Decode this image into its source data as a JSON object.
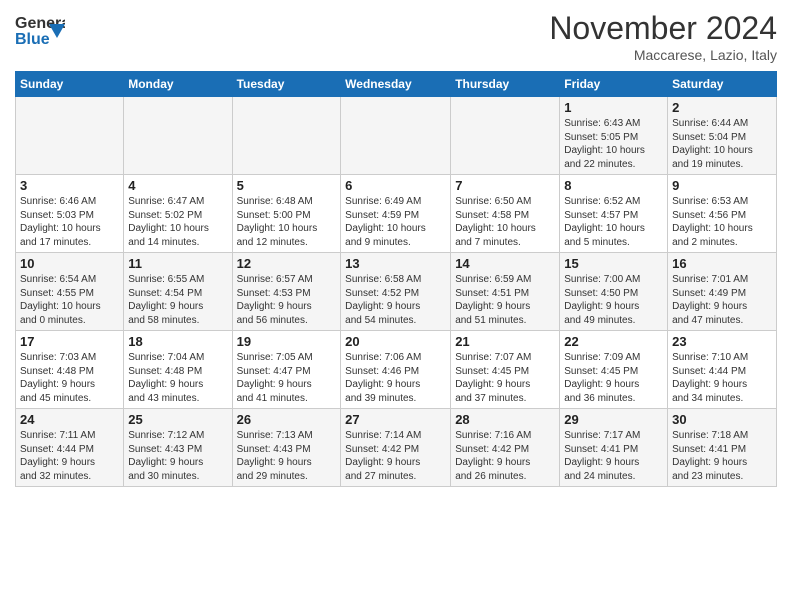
{
  "header": {
    "logo_line1": "General",
    "logo_line2": "Blue",
    "month": "November 2024",
    "location": "Maccarese, Lazio, Italy"
  },
  "weekdays": [
    "Sunday",
    "Monday",
    "Tuesday",
    "Wednesday",
    "Thursday",
    "Friday",
    "Saturday"
  ],
  "weeks": [
    [
      {
        "day": "",
        "info": ""
      },
      {
        "day": "",
        "info": ""
      },
      {
        "day": "",
        "info": ""
      },
      {
        "day": "",
        "info": ""
      },
      {
        "day": "",
        "info": ""
      },
      {
        "day": "1",
        "info": "Sunrise: 6:43 AM\nSunset: 5:05 PM\nDaylight: 10 hours\nand 22 minutes."
      },
      {
        "day": "2",
        "info": "Sunrise: 6:44 AM\nSunset: 5:04 PM\nDaylight: 10 hours\nand 19 minutes."
      }
    ],
    [
      {
        "day": "3",
        "info": "Sunrise: 6:46 AM\nSunset: 5:03 PM\nDaylight: 10 hours\nand 17 minutes."
      },
      {
        "day": "4",
        "info": "Sunrise: 6:47 AM\nSunset: 5:02 PM\nDaylight: 10 hours\nand 14 minutes."
      },
      {
        "day": "5",
        "info": "Sunrise: 6:48 AM\nSunset: 5:00 PM\nDaylight: 10 hours\nand 12 minutes."
      },
      {
        "day": "6",
        "info": "Sunrise: 6:49 AM\nSunset: 4:59 PM\nDaylight: 10 hours\nand 9 minutes."
      },
      {
        "day": "7",
        "info": "Sunrise: 6:50 AM\nSunset: 4:58 PM\nDaylight: 10 hours\nand 7 minutes."
      },
      {
        "day": "8",
        "info": "Sunrise: 6:52 AM\nSunset: 4:57 PM\nDaylight: 10 hours\nand 5 minutes."
      },
      {
        "day": "9",
        "info": "Sunrise: 6:53 AM\nSunset: 4:56 PM\nDaylight: 10 hours\nand 2 minutes."
      }
    ],
    [
      {
        "day": "10",
        "info": "Sunrise: 6:54 AM\nSunset: 4:55 PM\nDaylight: 10 hours\nand 0 minutes."
      },
      {
        "day": "11",
        "info": "Sunrise: 6:55 AM\nSunset: 4:54 PM\nDaylight: 9 hours\nand 58 minutes."
      },
      {
        "day": "12",
        "info": "Sunrise: 6:57 AM\nSunset: 4:53 PM\nDaylight: 9 hours\nand 56 minutes."
      },
      {
        "day": "13",
        "info": "Sunrise: 6:58 AM\nSunset: 4:52 PM\nDaylight: 9 hours\nand 54 minutes."
      },
      {
        "day": "14",
        "info": "Sunrise: 6:59 AM\nSunset: 4:51 PM\nDaylight: 9 hours\nand 51 minutes."
      },
      {
        "day": "15",
        "info": "Sunrise: 7:00 AM\nSunset: 4:50 PM\nDaylight: 9 hours\nand 49 minutes."
      },
      {
        "day": "16",
        "info": "Sunrise: 7:01 AM\nSunset: 4:49 PM\nDaylight: 9 hours\nand 47 minutes."
      }
    ],
    [
      {
        "day": "17",
        "info": "Sunrise: 7:03 AM\nSunset: 4:48 PM\nDaylight: 9 hours\nand 45 minutes."
      },
      {
        "day": "18",
        "info": "Sunrise: 7:04 AM\nSunset: 4:48 PM\nDaylight: 9 hours\nand 43 minutes."
      },
      {
        "day": "19",
        "info": "Sunrise: 7:05 AM\nSunset: 4:47 PM\nDaylight: 9 hours\nand 41 minutes."
      },
      {
        "day": "20",
        "info": "Sunrise: 7:06 AM\nSunset: 4:46 PM\nDaylight: 9 hours\nand 39 minutes."
      },
      {
        "day": "21",
        "info": "Sunrise: 7:07 AM\nSunset: 4:45 PM\nDaylight: 9 hours\nand 37 minutes."
      },
      {
        "day": "22",
        "info": "Sunrise: 7:09 AM\nSunset: 4:45 PM\nDaylight: 9 hours\nand 36 minutes."
      },
      {
        "day": "23",
        "info": "Sunrise: 7:10 AM\nSunset: 4:44 PM\nDaylight: 9 hours\nand 34 minutes."
      }
    ],
    [
      {
        "day": "24",
        "info": "Sunrise: 7:11 AM\nSunset: 4:44 PM\nDaylight: 9 hours\nand 32 minutes."
      },
      {
        "day": "25",
        "info": "Sunrise: 7:12 AM\nSunset: 4:43 PM\nDaylight: 9 hours\nand 30 minutes."
      },
      {
        "day": "26",
        "info": "Sunrise: 7:13 AM\nSunset: 4:43 PM\nDaylight: 9 hours\nand 29 minutes."
      },
      {
        "day": "27",
        "info": "Sunrise: 7:14 AM\nSunset: 4:42 PM\nDaylight: 9 hours\nand 27 minutes."
      },
      {
        "day": "28",
        "info": "Sunrise: 7:16 AM\nSunset: 4:42 PM\nDaylight: 9 hours\nand 26 minutes."
      },
      {
        "day": "29",
        "info": "Sunrise: 7:17 AM\nSunset: 4:41 PM\nDaylight: 9 hours\nand 24 minutes."
      },
      {
        "day": "30",
        "info": "Sunrise: 7:18 AM\nSunset: 4:41 PM\nDaylight: 9 hours\nand 23 minutes."
      }
    ]
  ]
}
